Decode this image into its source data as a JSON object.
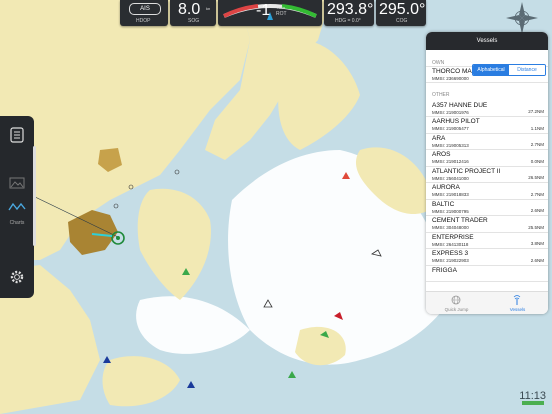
{
  "instruments": {
    "ais": {
      "label": "AIS",
      "sub": "HDOP"
    },
    "sog": {
      "value": "8.0",
      "unit": "kn",
      "label": "SOG"
    },
    "rot": {
      "value": "-1",
      "unit": "°/min",
      "label": "ROT"
    },
    "hdg": {
      "value": "293.8°",
      "label": "HDG = 0.0°"
    },
    "cog": {
      "value": "295.0°",
      "label": "COG"
    }
  },
  "panel": {
    "title": "Vessels",
    "own_label": "OWN",
    "own": {
      "name": "THORCO MANATEE",
      "mmsi": "MMSI: 236690000"
    },
    "other_label": "OTHER",
    "sort": {
      "alphabetical": "Alphabetical",
      "distance": "Distance"
    },
    "vessels": [
      {
        "name": "A357 HANNE DUE",
        "mmsi": "MMSI: 219001976",
        "dist": "27.2NM"
      },
      {
        "name": "AARHUS PILOT",
        "mmsi": "MMSI: 219005477",
        "dist": "1.1NM"
      },
      {
        "name": "ARA",
        "mmsi": "MMSI: 219005313",
        "dist": "2.7NM"
      },
      {
        "name": "AROS",
        "mmsi": "MMSI: 219012416",
        "dist": "0.0NM"
      },
      {
        "name": "ATLANTIC PROJECT II",
        "mmsi": "MMSI: 256041000",
        "dist": "26.5NM"
      },
      {
        "name": "AURORA",
        "mmsi": "MMSI: 219018833",
        "dist": "2.7NM"
      },
      {
        "name": "BALTIC",
        "mmsi": "MMSI: 219000795",
        "dist": "2.6NM"
      },
      {
        "name": "CEMENT TRADER",
        "mmsi": "MMSI: 304048000",
        "dist": "25.5NM"
      },
      {
        "name": "ENTERPRISE",
        "mmsi": "MMSI: 264130118",
        "dist": "3.8NM"
      },
      {
        "name": "EXPRESS 3",
        "mmsi": "MMSI: 219022903",
        "dist": "2.6NM"
      },
      {
        "name": "FRIGGA",
        "mmsi": "",
        "dist": ""
      }
    ],
    "tabs": {
      "quick_jump": "Quick Jump",
      "vessels": "Vessels"
    }
  },
  "toolbar": {
    "charts_label": "Charts"
  },
  "status": {
    "clock": "11:13"
  },
  "colors": {
    "land": "#f2e9b4",
    "shallow": "#c5dde6",
    "deep": "#ffffff",
    "urban": "#a98433",
    "panel_dark": "#27292d",
    "accent": "#2a7de1"
  }
}
